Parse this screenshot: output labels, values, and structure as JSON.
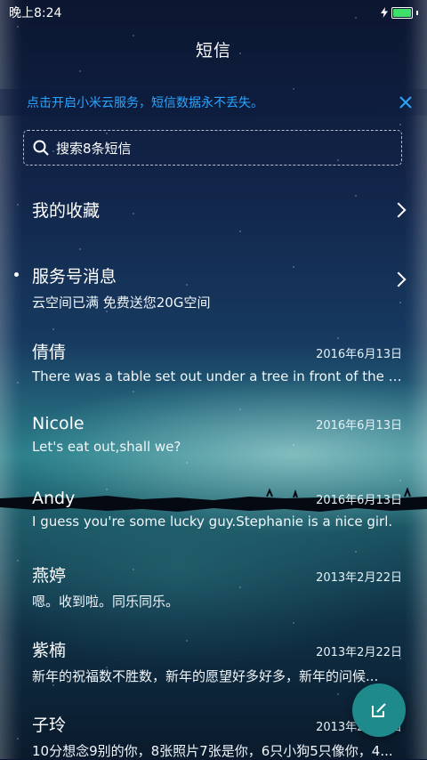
{
  "status_bar": {
    "time": "晚上8:24"
  },
  "header": {
    "title": "短信"
  },
  "banner": {
    "text": "点击开启小米云服务，短信数据永不丢失。"
  },
  "search": {
    "placeholder": "搜索8条短信"
  },
  "items": [
    {
      "name": "我的收藏",
      "has_chevron": true
    },
    {
      "name": "服务号消息",
      "preview": "云空间已满 免费送您20G空间",
      "has_chevron": true,
      "unread": true
    },
    {
      "name": "倩倩",
      "date": "2016年6月13日",
      "preview": "There was a table set out under a tree in front of the ho..."
    },
    {
      "name": "Nicole",
      "date": "2016年6月13日",
      "preview": "Let's eat out,shall we?"
    },
    {
      "name": "Andy",
      "date": "2016年6月13日",
      "preview": "I guess you're some lucky guy.Stephanie is a nice girl."
    },
    {
      "name": "燕婷",
      "date": "2013年2月22日",
      "preview": "嗯。收到啦。同乐同乐。"
    },
    {
      "name": "紫楠",
      "date": "2013年2月22日",
      "preview": "新年的祝福数不胜数，新年的愿望好多好多，新年的问候..."
    },
    {
      "name": "子玲",
      "date": "2013年2月22日",
      "preview": "10分想念9别的你，8张照片7张是你，6只小狗5只像你，4..."
    }
  ],
  "colors": {
    "accent": "#2aa5ff",
    "fab": "#1f8a8c",
    "battery": "#3fe06a"
  }
}
